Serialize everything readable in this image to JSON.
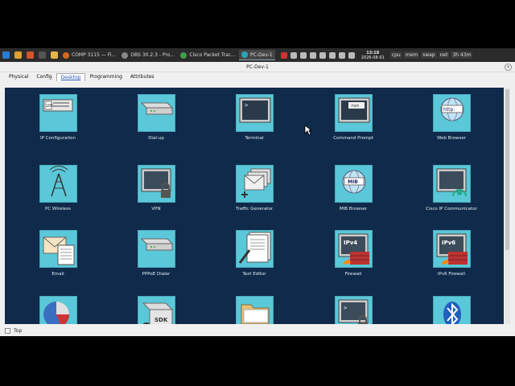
{
  "taskbar": {
    "tasks": [
      {
        "label": "COMP 3115 — Fi…",
        "color": "#d9661f"
      },
      {
        "label": "OBS 30.2.3 - Pro…",
        "color": "#888888"
      },
      {
        "label": "Cisco Packet Trac…",
        "color": "#3fa04a"
      },
      {
        "label": "PC-Dev-1",
        "color": "#2aa6b8",
        "active": true
      }
    ],
    "clock": {
      "time": "13:18",
      "date": "2026-08-01"
    },
    "monitors": [
      "cpu",
      "mem",
      "swap",
      "net"
    ],
    "uptime": "3h 43m"
  },
  "window": {
    "title": "PC-Dev-1",
    "tabs": [
      "Physical",
      "Config",
      "Desktop",
      "Programming",
      "Attributes"
    ],
    "active_tab": "Desktop",
    "bottom_checkbox_label": "Top"
  },
  "apps": [
    {
      "label": "IP Configuration",
      "icon": "ip-config-icon"
    },
    {
      "label": "Dial-up",
      "icon": "dialup-icon"
    },
    {
      "label": "Terminal",
      "icon": "terminal-icon"
    },
    {
      "label": "Command Prompt",
      "icon": "command-prompt-icon"
    },
    {
      "label": "Web Browser",
      "icon": "web-browser-icon"
    },
    {
      "label": "PC Wireless",
      "icon": "wireless-icon"
    },
    {
      "label": "VPN",
      "icon": "vpn-icon"
    },
    {
      "label": "Traffic Generator",
      "icon": "traffic-generator-icon"
    },
    {
      "label": "MIB Browser",
      "icon": "mib-browser-icon"
    },
    {
      "label": "Cisco IP Communicator",
      "icon": "ip-communicator-icon"
    },
    {
      "label": "Email",
      "icon": "email-icon"
    },
    {
      "label": "PPPoE Dialer",
      "icon": "pppoe-icon"
    },
    {
      "label": "Text Editor",
      "icon": "text-editor-icon"
    },
    {
      "label": "Firewall",
      "icon": "firewall-icon"
    },
    {
      "label": "IPv6 Firewall",
      "icon": "ipv6-firewall-icon"
    },
    {
      "label": "",
      "icon": "pie-chart-icon"
    },
    {
      "label": "",
      "icon": "sdk-icon"
    },
    {
      "label": "",
      "icon": "folder-icon"
    },
    {
      "label": "",
      "icon": "terminal-lock-icon"
    },
    {
      "label": "",
      "icon": "bluetooth-icon"
    }
  ],
  "icon_text": {
    "ip_number": "106",
    "run": "run",
    "http": "http:",
    "mib": "MIB",
    "ipv4": "IPv4",
    "ipv6": "IPv6",
    "sdk": "SDK",
    "prompt": ">"
  },
  "colors": {
    "desktop_bg": "#0f2a4a",
    "icon_bg": "#5ac8d8",
    "label_text": "#e8eef5"
  }
}
